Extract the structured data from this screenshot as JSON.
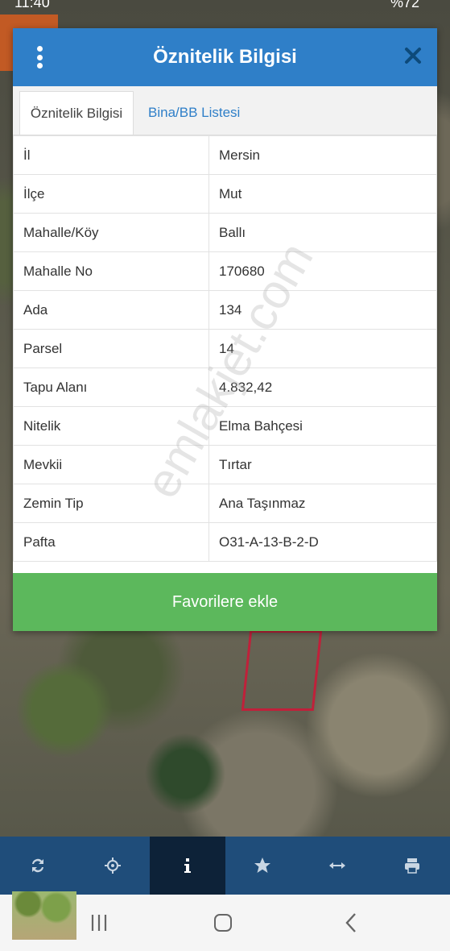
{
  "status_bar": {
    "time": "11:40",
    "battery": "%72"
  },
  "dialog": {
    "title": "Öznitelik Bilgisi",
    "tabs": [
      {
        "label": "Öznitelik Bilgisi",
        "active": true
      },
      {
        "label": "Bina/BB Listesi",
        "active": false
      }
    ],
    "rows": [
      {
        "key": "İl",
        "value": "Mersin"
      },
      {
        "key": "İlçe",
        "value": "Mut"
      },
      {
        "key": "Mahalle/Köy",
        "value": "Ballı"
      },
      {
        "key": "Mahalle No",
        "value": "170680"
      },
      {
        "key": "Ada",
        "value": "134"
      },
      {
        "key": "Parsel",
        "value": "14"
      },
      {
        "key": "Tapu Alanı",
        "value": "4.832,42"
      },
      {
        "key": "Nitelik",
        "value": "Elma Bahçesi"
      },
      {
        "key": "Mevkii",
        "value": "Tırtar"
      },
      {
        "key": "Zemin Tip",
        "value": "Ana Taşınmaz"
      },
      {
        "key": "Pafta",
        "value": "O31-A-13-B-2-D"
      }
    ],
    "favorite_button": "Favorilere ekle"
  },
  "watermark": "emlakjet.com",
  "toolbar": {
    "items": [
      "refresh-icon",
      "locate-icon",
      "info-icon",
      "star-icon",
      "measure-icon",
      "print-icon"
    ],
    "active_index": 2
  },
  "colors": {
    "header": "#2f7fc8",
    "favorite": "#5cb85c",
    "toolbar": "#1f4d7a",
    "toolbar_active": "#0d2238",
    "parcel": "#c0203a"
  }
}
